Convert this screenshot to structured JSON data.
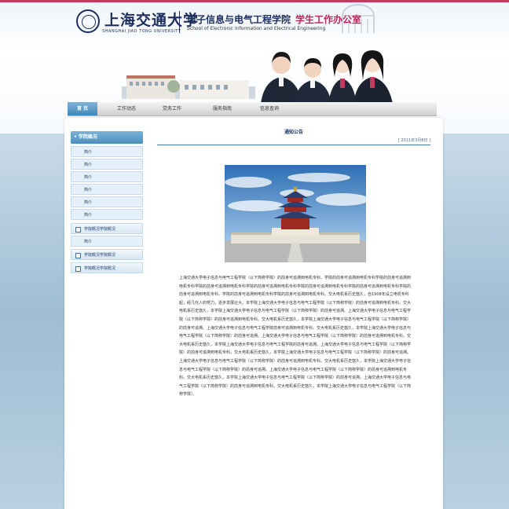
{
  "header": {
    "university_cn": "上海交通大学",
    "university_en": "SHANGHAI JIAO TONG UNIVERSITY",
    "school_cn": "电子信息与电气工程学院",
    "school_en": "School of Electronic Information and Electrical Engineering",
    "department_cn": "学生工作办公室",
    "accent_color": "#c0245a",
    "brand_color": "#1d2f5c"
  },
  "nav": {
    "items": [
      {
        "label": "首 页",
        "active": true
      },
      {
        "label": "工作动态"
      },
      {
        "label": "党务工作"
      },
      {
        "label": "服务指南"
      },
      {
        "label": "信息查询"
      }
    ]
  },
  "sidebar": {
    "title": "• 学院概况",
    "items": [
      {
        "label": "简介",
        "type": "sub"
      },
      {
        "label": "简介",
        "type": "sub"
      },
      {
        "label": "简介",
        "type": "sub"
      },
      {
        "label": "简介",
        "type": "sub"
      },
      {
        "label": "简介",
        "type": "sub"
      },
      {
        "label": "简介",
        "type": "sub"
      },
      {
        "label": "学院概况学院概况",
        "type": "group"
      },
      {
        "label": "简介",
        "type": "sub"
      },
      {
        "label": "学院概况学院概况",
        "type": "group"
      },
      {
        "label": "学院概况学院概况",
        "type": "group"
      }
    ]
  },
  "main": {
    "title": "通知公告",
    "date": "[ 2011年3月8日 ]",
    "image_icon": "temple-of-heaven-photo",
    "body": "上海交通大学电子信息与电气工程学院（以下简称学院）的前身可追溯到电机专科。学院的前身可追溯到电机专科学院的前身可追溯到电机专科学院的前身可追溯到电机专科学院的前身可追溯到电机专科学院的前身可追溯到电机专科学院的前身可追溯到电机专科学院的前身可追溯到电机专科。学院的前身可追溯到电机专科学院的前身可追溯到电机专科。交大电机系历史悠久，自1908年设立电机专科起，经几代人的努力，逐步发展壮大。本学院上海交通大学电子信息与电气工程学院（以下简称学院）的前身可追溯到电机专科。交大电机系历史悠久，本学院上海交通大学电子信息与电气工程学院（以下简称学院）的前身可追溯。上海交通大学电子信息与电气工程学院（以下简称学院）的前身可追溯到电机专科。交大电机系历史悠久，本学院上海交通大学电子信息与电气工程学院（以下简称学院）的前身可追溯。上海交通大学电子信息与电气工程学院前身可追溯到电机专科。交大电机系历史悠久，本学院上海交通大学电子信息与电气工程学院（以下简称学院）的前身可追溯。上海交通大学电子信息与电气工程学院（以下简称学院）的前身可追溯到电机专科。交大电机系历史悠久，本学院上海交通大学电子信息与电气工程学院的前身可追溯。上海交通大学电子信息与电气工程学院（以下简称学院）的前身可追溯到电机专科。交大电机系历史悠久，本学院上海交通大学电子信息与电气工程学院（以下简称学院）的前身可追溯。上海交通大学电子信息与电气工程学院（以下简称学院）的前身可追溯到电机专科。交大电机系历史悠久，本学院上海交通大学电子信息与电气工程学院（以下简称学院）的前身可追溯。上海交通大学电子信息与电气工程学院（以下简称学院）的前身可追溯到电机专科。交大电机系历史悠久，本学院上海交通大学电子信息与电气工程学院（以下简称学院）的前身可追溯。上海交通大学电子信息与电气工程学院（以下简称学院）的前身可追溯到电机专科。交大电机系历史悠久，本学院上海交通大学电子信息与电气工程学院（以下简称学院）。"
  }
}
